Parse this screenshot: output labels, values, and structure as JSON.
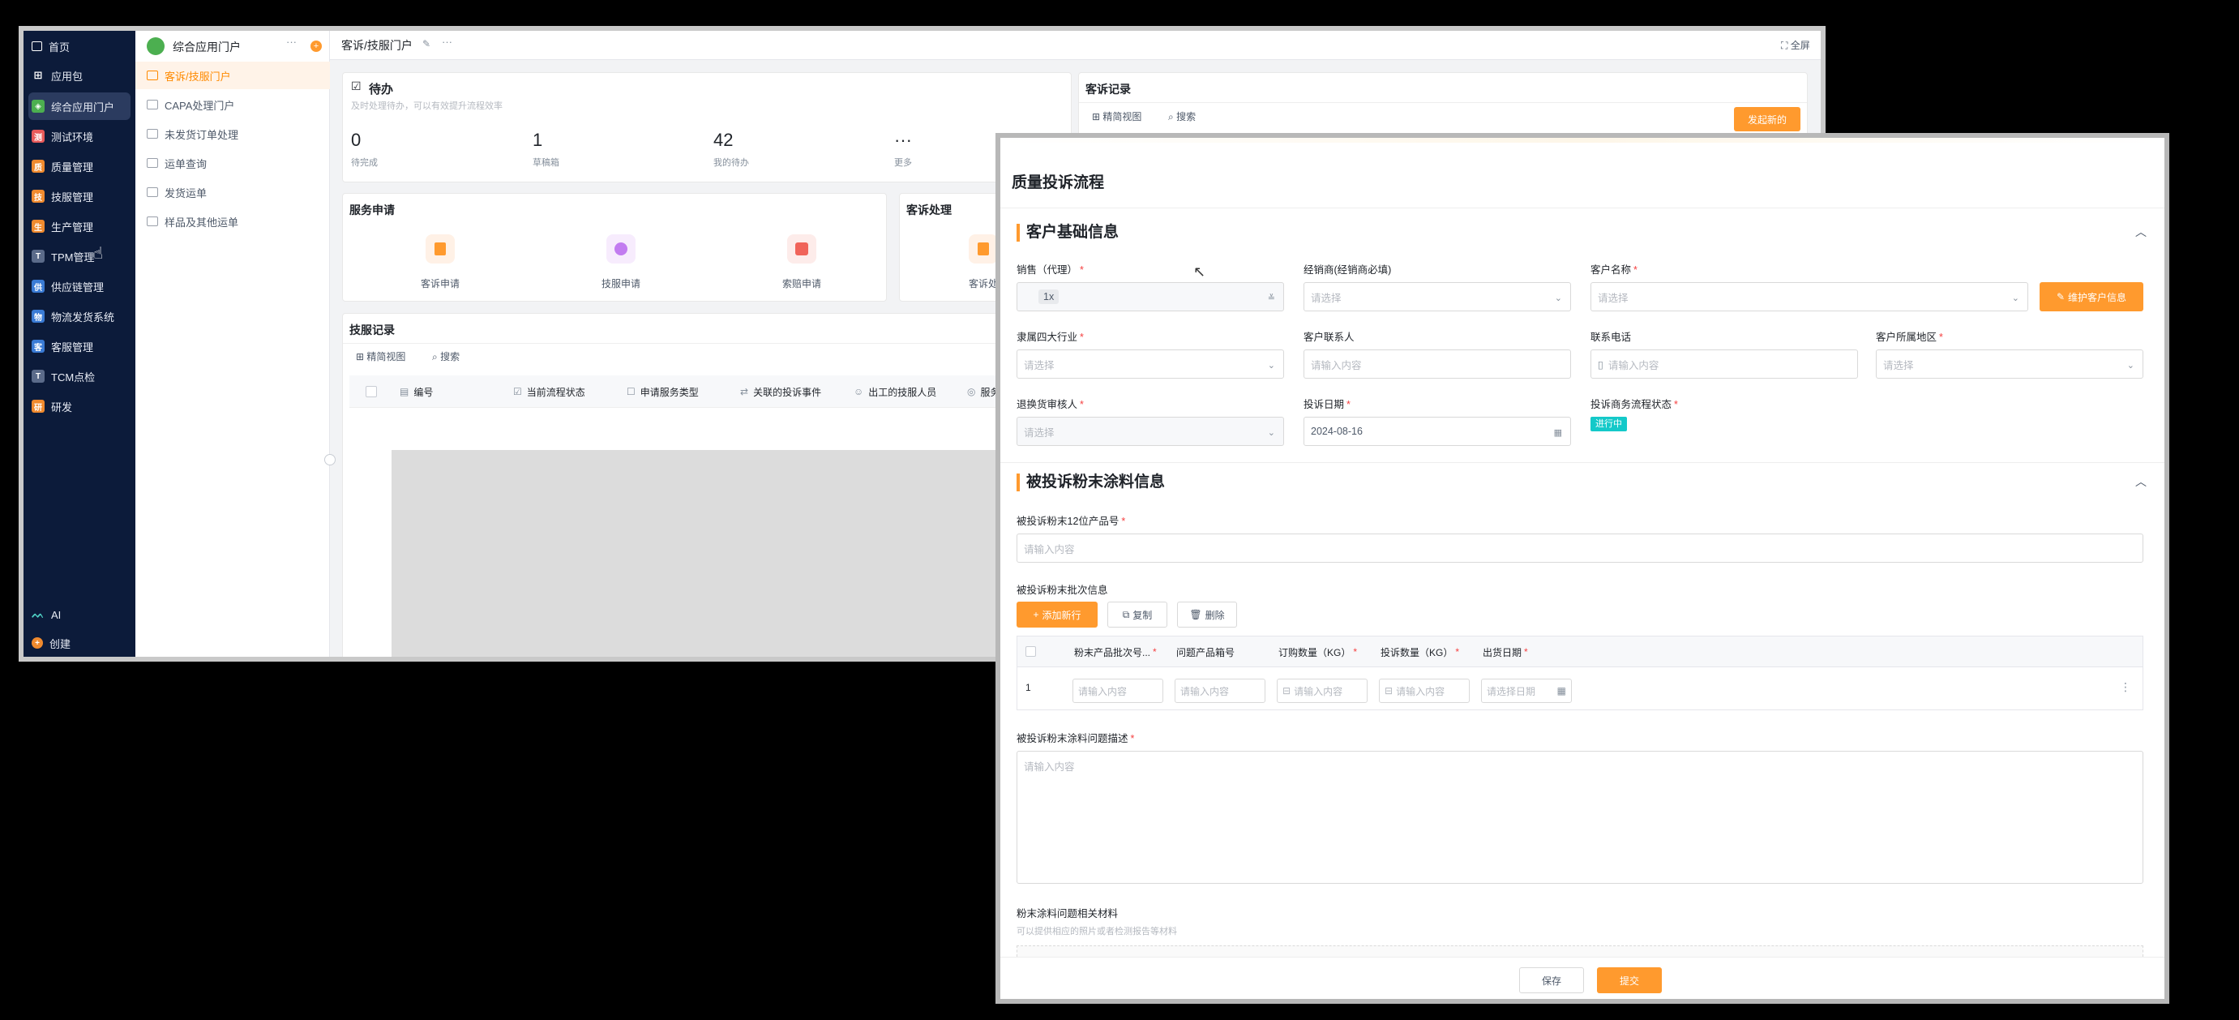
{
  "nav": {
    "items": [
      {
        "label": "首页"
      },
      {
        "label": "应用包"
      },
      {
        "label": "综合应用门户"
      },
      {
        "label": "测试环境"
      },
      {
        "label": "质量管理"
      },
      {
        "label": "技服管理"
      },
      {
        "label": "生产管理"
      },
      {
        "label": "TPM管理"
      },
      {
        "label": "供应链管理"
      },
      {
        "label": "物流发货系统"
      },
      {
        "label": "客服管理"
      },
      {
        "label": "TCM点检"
      },
      {
        "label": "研发"
      }
    ],
    "ai_label": "AI",
    "create_label": "创建"
  },
  "portal": {
    "title": "综合应用门户",
    "more": "···",
    "menu": [
      {
        "label": "客诉/技服门户"
      },
      {
        "label": "CAPA处理门户"
      },
      {
        "label": "未发货订单处理"
      },
      {
        "label": "运单查询"
      },
      {
        "label": "发货运单"
      },
      {
        "label": "样品及其他运单"
      }
    ]
  },
  "page": {
    "breadcrumb": "客诉/技服门户",
    "more": "···",
    "fullscreen": "全屏",
    "todo": {
      "title": "待办",
      "subtitle": "及时处理待办，可以有效提升流程效率",
      "stats": [
        {
          "value": "0",
          "label": "待完成"
        },
        {
          "value": "1",
          "label": "草稿箱"
        },
        {
          "value": "42",
          "label": "我的待办"
        },
        {
          "value": "···",
          "label": "更多"
        }
      ]
    },
    "complaint_records": {
      "title": "客诉记录",
      "view": "精简视图",
      "search": "搜索",
      "new_button": "发起新的"
    },
    "service_request": {
      "title": "服务申请",
      "items": [
        {
          "label": "客诉申请",
          "color": "#ff9a2e"
        },
        {
          "label": "技服申请",
          "color": "#c27cf0"
        },
        {
          "label": "索赔申请",
          "color": "#f0645a"
        }
      ]
    },
    "complaint_handling": {
      "title": "客诉处理",
      "item": "客诉处"
    },
    "tech_records": {
      "title": "技服记录",
      "view": "精简视图",
      "search": "搜索",
      "columns": [
        "编号",
        "当前流程状态",
        "申请服务类型",
        "关联的投诉事件",
        "出工的技服人员",
        "服务"
      ]
    }
  },
  "modal": {
    "title": "质量投诉流程",
    "section1": {
      "title": "客户基础信息",
      "fields": {
        "sales": {
          "label": "销售（代理）",
          "value": "1x"
        },
        "dealer": {
          "label": "经销商(经销商必填)",
          "placeholder": "请选择"
        },
        "customer": {
          "label": "客户名称",
          "placeholder": "请选择"
        },
        "maintain_button": "维护客户信息",
        "industry": {
          "label": "隶属四大行业",
          "placeholder": "请选择"
        },
        "contact": {
          "label": "客户联系人",
          "placeholder": "请输入内容"
        },
        "phone": {
          "label": "联系电话",
          "placeholder": "请输入内容"
        },
        "region": {
          "label": "客户所属地区",
          "placeholder": "请选择"
        },
        "reviewer": {
          "label": "退换货审核人",
          "placeholder": "请选择"
        },
        "complaint_date": {
          "label": "投诉日期",
          "value": "2024-08-16"
        },
        "business_status": {
          "label": "投诉商务流程状态",
          "value": "进行中"
        }
      }
    },
    "section2": {
      "title": "被投诉粉末涂料信息",
      "product_code": {
        "label": "被投诉粉末12位产品号",
        "placeholder": "请输入内容"
      },
      "batch_info_label": "被投诉粉末批次信息",
      "buttons": {
        "add": "添加新行",
        "copy": "复制",
        "delete": "删除"
      },
      "table": {
        "columns": [
          "粉末产品批次号...",
          "问题产品箱号",
          "订购数量（KG）",
          "投诉数量（KG）",
          "出货日期"
        ],
        "rows": [
          {
            "index": "1",
            "batch": "请输入内容",
            "box": "请输入内容",
            "order_qty": "请输入内容",
            "complaint_qty": "请输入内容",
            "ship_date": "请选择日期"
          }
        ]
      },
      "description": {
        "label": "被投诉粉末涂料问题描述",
        "placeholder": "请输入内容"
      },
      "materials": {
        "label": "粉末涂料问题相关材料",
        "hint": "可以提供相应的照片或者检测报告等材料"
      }
    },
    "footer": {
      "save": "保存",
      "submit": "提交"
    }
  },
  "colors": {
    "accent": "#ff9a2e",
    "nav_bg": "#0c1b3a",
    "status_tag": "#14c9c9"
  }
}
